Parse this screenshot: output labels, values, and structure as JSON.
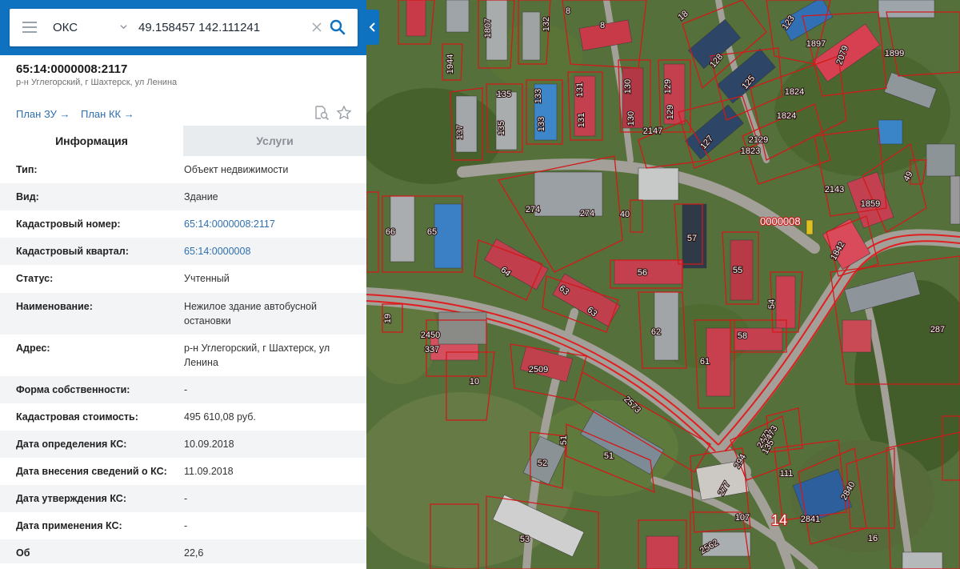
{
  "search": {
    "type_label": "ОКС",
    "coordinates": "49.158457 142.111241"
  },
  "object": {
    "cadastral_number": "65:14:0000008:2117",
    "address_short": "р-н Углегорский, г Шахтерск, ул Ленина"
  },
  "links": {
    "plan_zu": "План ЗУ",
    "plan_kk": "План КК"
  },
  "tabs": {
    "info": "Информация",
    "services": "Услуги"
  },
  "info_rows": [
    {
      "key": "Тип:",
      "value": "Объект недвижимости"
    },
    {
      "key": "Вид:",
      "value": "Здание"
    },
    {
      "key": "Кадастровый номер:",
      "value": "65:14:0000008:2117"
    },
    {
      "key": "Кадастровый квартал:",
      "value": "65:14:0000008"
    },
    {
      "key": "Статус:",
      "value": "Учтенный"
    },
    {
      "key": "Наименование:",
      "value": "Нежилое здание автобусной остановки"
    },
    {
      "key": "Адрес:",
      "value": "р-н Углегорский, г Шахтерск, ул Ленина"
    },
    {
      "key": "Форма собственности:",
      "value": "-"
    },
    {
      "key": "Кадастровая стоимость:",
      "value": "495 610,08 руб."
    },
    {
      "key": "Дата определения КС:",
      "value": "10.09.2018"
    },
    {
      "key": "Дата внесения сведений о КС:",
      "value": "11.09.2018"
    },
    {
      "key": "Дата утверждения КС:",
      "value": "-"
    },
    {
      "key": "Дата применения КС:",
      "value": "-"
    },
    {
      "key": "Об",
      "value": "22,6"
    }
  ],
  "map": {
    "parcel_labels": [
      "1807",
      "132",
      "8",
      "8",
      "1944",
      "135",
      "135",
      "133",
      "133",
      "131",
      "131",
      "130",
      "130",
      "129",
      "129",
      "137",
      "2147",
      "128",
      "125",
      "123",
      "1897",
      "2079",
      "1899",
      "1824",
      "1824",
      "1823",
      "2129",
      "127",
      "2143",
      "1859",
      "49",
      "274",
      "274",
      "40",
      "66",
      "65",
      "57",
      "55",
      "64",
      "56",
      "54",
      "1842",
      "63",
      "63",
      "62",
      "58",
      "287",
      "61",
      "19",
      "2450",
      "337",
      "2509",
      "10",
      "2573",
      "52",
      "51",
      "51",
      "2473",
      "2473",
      "294",
      "135",
      "111",
      "277",
      "107",
      "2841",
      "2840",
      "16",
      "53",
      "2562",
      "18"
    ],
    "quarter_label": "0000008",
    "quarter_label_2": "14",
    "colors": {
      "parcel_border": "#d11a1a",
      "roof_red": "#c93a48",
      "roof_blue": "#2f79c4",
      "vegetation": "#4d6a2e"
    }
  }
}
